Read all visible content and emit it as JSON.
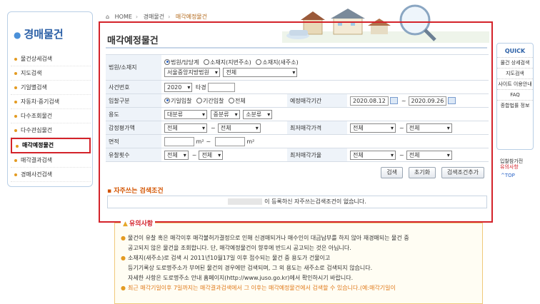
{
  "sidebar": {
    "title": "경매물건",
    "items": [
      {
        "label": "물건상세검색"
      },
      {
        "label": "지도검색"
      },
      {
        "label": "기일별검색"
      },
      {
        "label": "자동차·중기검색"
      },
      {
        "label": "다수조회물건"
      },
      {
        "label": "다수관심물건"
      },
      {
        "label": "매각예정물건"
      },
      {
        "label": "매각결과검색"
      },
      {
        "label": "경매사건검색"
      }
    ]
  },
  "breadcrumb": [
    "HOME",
    "경매물건",
    "매각예정물건"
  ],
  "page_title": "매각예정물건",
  "form": {
    "court_label": "법원/소재지",
    "court_radios": [
      "법원/담당계",
      "소재지(지번주소)",
      "소재지(새주소)"
    ],
    "court_select": "서울중앙지방법원",
    "court_sub_select": "전체",
    "case_label": "사건번호",
    "case_year": "2020",
    "case_suffix": "타경",
    "bid_label": "입찰구분",
    "bid_radios": [
      "기일입찰",
      "기간입찰",
      "전체"
    ],
    "date_label": "예정매각기간",
    "date_from": "2020.08.12",
    "date_to": "2020.09.26",
    "use_label": "용도",
    "use_selects": [
      "대분류",
      "중분류",
      "소분류"
    ],
    "appraisal_label": "감정평가액",
    "appraisal_from": "전체",
    "appraisal_to": "전체",
    "min_price_label": "최저매각가격",
    "min_price_from": "전체",
    "min_price_to": "전체",
    "area_label": "면적",
    "area_unit": "m²",
    "fail_label": "유찰횟수",
    "fail_from": "전체",
    "fail_to": "전체",
    "min_rate_label": "최저매각가율",
    "min_rate_from": "전체",
    "min_rate_to": "전체"
  },
  "buttons": {
    "search": "검색",
    "reset": "초기화",
    "add_condition": "검색조건추가"
  },
  "favorites": {
    "title": "자주쓰는 검색조건",
    "message": "이 등록하신 자주쓰는검색조건이 없습니다."
  },
  "quick": {
    "title": "QUICK",
    "items": [
      "물건 상세검색",
      "지도검색",
      "사이트 이용안내",
      "FAQ",
      "종합법률 정보"
    ],
    "side1": "입찰참가전",
    "side2": "유의사항",
    "top": "^TOP"
  },
  "notice": {
    "title": "유의사항",
    "line1": "물건이 유찰 혹은 매각이후 매각불허가결정으로 인해 신경매되거나 매수인이 대금납부를 하지 않아 재경매되는 물건 중",
    "line1b": "공고되지 않은 물건을 조회합니다. 단, 매각예정물건이 향후에 반드시 공고되는 것은 아닙니다.",
    "line2": "소재지(새주소)로 검색 시 2011년10월17일 이후 접수되는 물건 중 용도가 건물이고",
    "line2b": "등기기록상 도로명주소가 부여된 물건의 경우에만 검색되며, 그 외 용도는 새주소로 검색되지 않습니다.",
    "line2c": "자세한 사항은 도로명주소 안내 홈페이지(http://www.juso.go.kr)에서 확인하시기 바랍니다.",
    "line3": "최근 매각기일이후 7일까지는 매각결과검색에서 그 이후는 매각예정물건에서 검색할 수 있습니다.(예:매각기일이"
  },
  "colors": {
    "accent": "#d4232a",
    "brand": "#2a5fa6",
    "bullet": "#e39b22"
  }
}
